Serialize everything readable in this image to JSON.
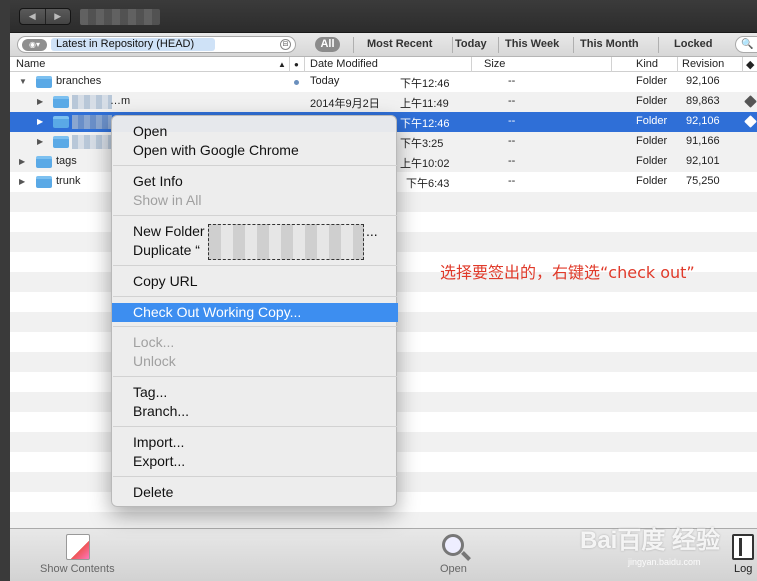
{
  "filterbar": {
    "repo_select_icon": "eye-icon",
    "repo_label": "Latest in Repository (HEAD)",
    "filters": {
      "all": "All",
      "most_recent": "Most Recent",
      "today": "Today",
      "this_week": "This Week",
      "this_month": "This Month",
      "locked": "Locked"
    }
  },
  "columns": {
    "name": "Name",
    "date_modified": "Date Modified",
    "size": "Size",
    "kind": "Kind",
    "revision": "Revision"
  },
  "rows": [
    {
      "name": "branches",
      "date": "Today",
      "time": "下午12:46",
      "size": "--",
      "kind": "Folder",
      "revision": "92,106"
    },
    {
      "name": "…m",
      "date": "2014年9月2日",
      "time": "上午11:49",
      "size": "--",
      "kind": "Folder",
      "revision": "89,863"
    },
    {
      "name": "",
      "date": "",
      "time": "下午12:46",
      "size": "--",
      "kind": "Folder",
      "revision": "92,106"
    },
    {
      "name": "",
      "date": "",
      "time": "下午3:25",
      "size": "--",
      "kind": "Folder",
      "revision": "91,166"
    },
    {
      "name": "tags",
      "date": "",
      "time": "上午10:02",
      "size": "--",
      "kind": "Folder",
      "revision": "92,101"
    },
    {
      "name": "trunk",
      "date": "",
      "time": "下午6:43",
      "size": "--",
      "kind": "Folder",
      "revision": "75,250"
    }
  ],
  "context_menu": {
    "open": "Open",
    "open_chrome": "Open with Google Chrome",
    "get_info": "Get Info",
    "show_in_all": "Show in All",
    "new_folder": "New Folder",
    "duplicate": "Duplicate “",
    "copy_url": "Copy URL",
    "check_out": "Check Out Working Copy...",
    "lock": "Lock...",
    "unlock": "Unlock",
    "tag": "Tag...",
    "branch": "Branch...",
    "import": "Import...",
    "export": "Export...",
    "delete": "Delete"
  },
  "annotation": "选择要签出的，右键选“check out”",
  "bottom_toolbar": {
    "show_contents": "Show Contents",
    "open": "Open",
    "log": "Log"
  },
  "watermark": {
    "main": "Bai百度 经验",
    "sub": "jingyan.baidu.com"
  }
}
